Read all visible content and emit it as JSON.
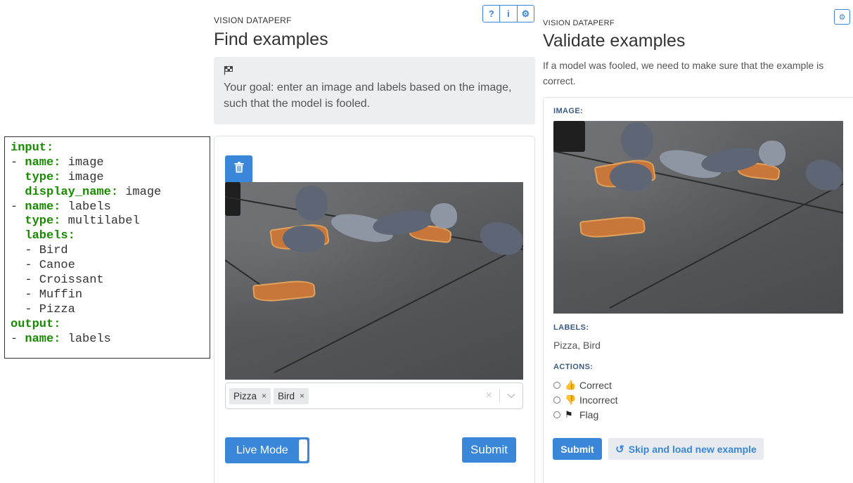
{
  "config": {
    "lines": [
      {
        "key": "input:",
        "value": ""
      },
      {
        "prefix": "- ",
        "key": "name:",
        "value": " image"
      },
      {
        "prefix": "  ",
        "key": "type:",
        "value": " image"
      },
      {
        "prefix": "  ",
        "key": "display_name:",
        "value": " image"
      },
      {
        "prefix": "- ",
        "key": "name:",
        "value": " labels"
      },
      {
        "prefix": "  ",
        "key": "type:",
        "value": " multilabel"
      },
      {
        "prefix": "  ",
        "key": "labels:",
        "value": ""
      },
      {
        "prefix": "  - Bird",
        "key": "",
        "value": ""
      },
      {
        "prefix": "  - Canoe",
        "key": "",
        "value": ""
      },
      {
        "prefix": "  - Croissant",
        "key": "",
        "value": ""
      },
      {
        "prefix": "  - Muffin",
        "key": "",
        "value": ""
      },
      {
        "prefix": "  - Pizza",
        "key": "",
        "value": ""
      },
      {
        "key": "output:",
        "value": ""
      },
      {
        "prefix": "- ",
        "key": "name:",
        "value": " labels"
      }
    ]
  },
  "find": {
    "eyebrow": "VISION DATAPERF",
    "title": "Find examples",
    "top_buttons": [
      "?",
      "i",
      "⚙"
    ],
    "goal_icon": "checkered-flag-icon",
    "goal_text": "Your goal: enter an image and labels based on the image, such that the model is fooled.",
    "selected_labels": [
      "Pizza",
      "Bird"
    ],
    "tag_remove": "×",
    "clear_glyph": "×",
    "dropdown_glyph": "⌄",
    "live_mode_label": "Live Mode",
    "submit_label": "Submit"
  },
  "validate": {
    "eyebrow": "VISION DATAPERF",
    "title": "Validate examples",
    "settings_glyph": "⚙",
    "description": "If a model was fooled, we need to make sure that the example is correct.",
    "image_label": "IMAGE:",
    "labels_label": "LABELS:",
    "labels_value": "Pizza, Bird",
    "actions_label": "ACTIONS:",
    "actions": [
      {
        "icon": "thumbs-up-icon",
        "glyph": "👍",
        "label": "Correct"
      },
      {
        "icon": "thumbs-down-icon",
        "glyph": "👎",
        "label": "Incorrect"
      },
      {
        "icon": "flag-icon",
        "glyph": "⚑",
        "label": "Flag"
      }
    ],
    "submit_label": "Submit",
    "skip_glyph": "↺",
    "skip_label": "Skip and load new example"
  },
  "colors": {
    "primary": "#3a86d8",
    "yaml_key": "#188a00",
    "section_label": "#3b5b82",
    "goal_bg": "#eceef0"
  }
}
